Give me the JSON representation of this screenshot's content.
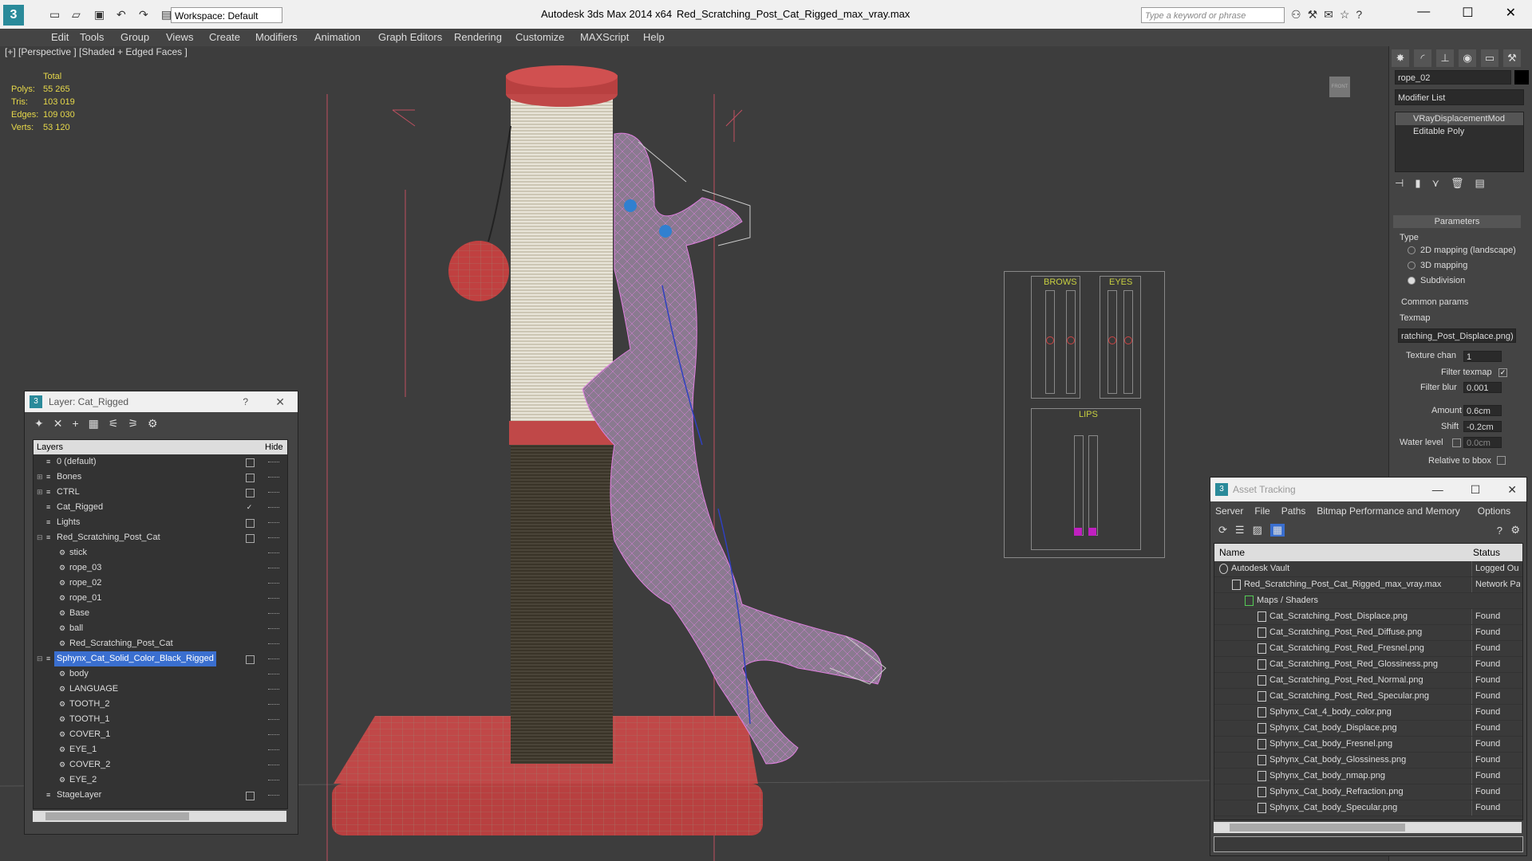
{
  "titlebar": {
    "logo": "3",
    "workspace": "Workspace: Default",
    "app_title": "Autodesk 3ds Max  2014 x64",
    "document": "Red_Scratching_Post_Cat_Rigged_max_vray.max",
    "search_placeholder": "Type a keyword or phrase"
  },
  "menu": [
    "Edit",
    "Tools",
    "Group",
    "Views",
    "Create",
    "Modifiers",
    "Animation",
    "Graph Editors",
    "Rendering",
    "Customize",
    "MAXScript",
    "Help"
  ],
  "viewport": {
    "label": "[+] [Perspective ] [Shaded + Edged Faces ]",
    "navcube": "FRONT",
    "stats": {
      "header": "Total",
      "rows": [
        {
          "k": "Polys:",
          "v": "55 265"
        },
        {
          "k": "Tris:",
          "v": "103 019"
        },
        {
          "k": "Edges:",
          "v": "109 030"
        },
        {
          "k": "Verts:",
          "v": "53 120"
        }
      ]
    },
    "hud": {
      "brows": "BROWS",
      "eyes": "EYES",
      "lips": "LIPS"
    }
  },
  "command_panel": {
    "object_name": "rope_02",
    "modifier_list": "Modifier List",
    "stack": [
      "VRayDisplacementMod",
      "Editable Poly"
    ],
    "parameters_title": "Parameters",
    "type_label": "Type",
    "type_options": [
      {
        "label": "2D mapping (landscape)",
        "on": false
      },
      {
        "label": "3D mapping",
        "on": false
      },
      {
        "label": "Subdivision",
        "on": true
      }
    ],
    "common_params": "Common params",
    "texmap_label": "Texmap",
    "texmap_value": "ratching_Post_Displace.png)",
    "texture_chan_label": "Texture chan",
    "texture_chan_value": "1",
    "filter_texmap_label": "Filter texmap",
    "filter_blur_label": "Filter blur",
    "filter_blur_value": "0.001",
    "amount_label": "Amount",
    "amount_value": "0.6cm",
    "shift_label": "Shift",
    "shift_value": "-0.2cm",
    "water_level_label": "Water level",
    "water_level_value": "0.0cm",
    "relative_label": "Relative to bbox"
  },
  "layer_window": {
    "title": "Layer: Cat_Rigged",
    "help": "?",
    "close": "✕",
    "col_layers": "Layers",
    "col_hide": "Hide",
    "rows": [
      {
        "name": "0 (default)",
        "indent": 1,
        "exp": "",
        "hb": "box"
      },
      {
        "name": "Bones",
        "indent": 1,
        "exp": "+",
        "hb": "box"
      },
      {
        "name": "CTRL",
        "indent": 1,
        "exp": "+",
        "hb": "box"
      },
      {
        "name": "Cat_Rigged",
        "indent": 1,
        "exp": "",
        "hb": "check"
      },
      {
        "name": "Lights",
        "indent": 1,
        "exp": "",
        "hb": "box"
      },
      {
        "name": "Red_Scratching_Post_Cat",
        "indent": 1,
        "exp": "−",
        "hb": "box"
      },
      {
        "name": "stick",
        "indent": 2,
        "exp": "",
        "hb": ""
      },
      {
        "name": "rope_03",
        "indent": 2,
        "exp": "",
        "hb": ""
      },
      {
        "name": "rope_02",
        "indent": 2,
        "exp": "",
        "hb": ""
      },
      {
        "name": "rope_01",
        "indent": 2,
        "exp": "",
        "hb": ""
      },
      {
        "name": "Base",
        "indent": 2,
        "exp": "",
        "hb": ""
      },
      {
        "name": "ball",
        "indent": 2,
        "exp": "",
        "hb": ""
      },
      {
        "name": "Red_Scratching_Post_Cat",
        "indent": 2,
        "exp": "",
        "hb": ""
      },
      {
        "name": "Sphynx_Cat_Solid_Color_Black_Rigged",
        "indent": 1,
        "exp": "−",
        "hb": "box",
        "sel": true
      },
      {
        "name": "body",
        "indent": 2,
        "exp": "",
        "hb": ""
      },
      {
        "name": "LANGUAGE",
        "indent": 2,
        "exp": "",
        "hb": ""
      },
      {
        "name": "TOOTH_2",
        "indent": 2,
        "exp": "",
        "hb": ""
      },
      {
        "name": "TOOTH_1",
        "indent": 2,
        "exp": "",
        "hb": ""
      },
      {
        "name": "COVER_1",
        "indent": 2,
        "exp": "",
        "hb": ""
      },
      {
        "name": "EYE_1",
        "indent": 2,
        "exp": "",
        "hb": ""
      },
      {
        "name": "COVER_2",
        "indent": 2,
        "exp": "",
        "hb": ""
      },
      {
        "name": "EYE_2",
        "indent": 2,
        "exp": "",
        "hb": ""
      },
      {
        "name": "StageLayer",
        "indent": 1,
        "exp": "",
        "hb": "box"
      }
    ]
  },
  "asset_window": {
    "title": "Asset Tracking",
    "menu": [
      "Server",
      "File",
      "Paths",
      "Bitmap Performance and Memory",
      "Options"
    ],
    "col_name": "Name",
    "col_status": "Status",
    "rows": [
      {
        "name": "Autodesk Vault",
        "status": "Logged Ou",
        "indent": 0,
        "icon": "vault"
      },
      {
        "name": "Red_Scratching_Post_Cat_Rigged_max_vray.max",
        "status": "Network Pa",
        "indent": 1,
        "icon": "max"
      },
      {
        "name": "Maps / Shaders",
        "status": "",
        "indent": 2,
        "icon": "maps"
      },
      {
        "name": "Cat_Scratching_Post_Displace.png",
        "status": "Found",
        "indent": 3,
        "icon": "file"
      },
      {
        "name": "Cat_Scratching_Post_Red_Diffuse.png",
        "status": "Found",
        "indent": 3,
        "icon": "file"
      },
      {
        "name": "Cat_Scratching_Post_Red_Fresnel.png",
        "status": "Found",
        "indent": 3,
        "icon": "file"
      },
      {
        "name": "Cat_Scratching_Post_Red_Glossiness.png",
        "status": "Found",
        "indent": 3,
        "icon": "file"
      },
      {
        "name": "Cat_Scratching_Post_Red_Normal.png",
        "status": "Found",
        "indent": 3,
        "icon": "file"
      },
      {
        "name": "Cat_Scratching_Post_Red_Specular.png",
        "status": "Found",
        "indent": 3,
        "icon": "file"
      },
      {
        "name": "Sphynx_Cat_4_body_color.png",
        "status": "Found",
        "indent": 3,
        "icon": "file"
      },
      {
        "name": "Sphynx_Cat_body_Displace.png",
        "status": "Found",
        "indent": 3,
        "icon": "file"
      },
      {
        "name": "Sphynx_Cat_body_Fresnel.png",
        "status": "Found",
        "indent": 3,
        "icon": "file"
      },
      {
        "name": "Sphynx_Cat_body_Glossiness.png",
        "status": "Found",
        "indent": 3,
        "icon": "file"
      },
      {
        "name": "Sphynx_Cat_body_nmap.png",
        "status": "Found",
        "indent": 3,
        "icon": "file"
      },
      {
        "name": "Sphynx_Cat_body_Refraction.png",
        "status": "Found",
        "indent": 3,
        "icon": "file"
      },
      {
        "name": "Sphynx_Cat_body_Specular.png",
        "status": "Found",
        "indent": 3,
        "icon": "file"
      }
    ]
  },
  "colors": {
    "wire_pink": "#e080e0",
    "post_red": "#d05050",
    "rope_white": "#e8e4d8",
    "rope_dark": "#4a4438",
    "stats_yellow": "#e6d84a",
    "hud_green": "#c8d040",
    "selection_blue": "#3a6fd0"
  }
}
